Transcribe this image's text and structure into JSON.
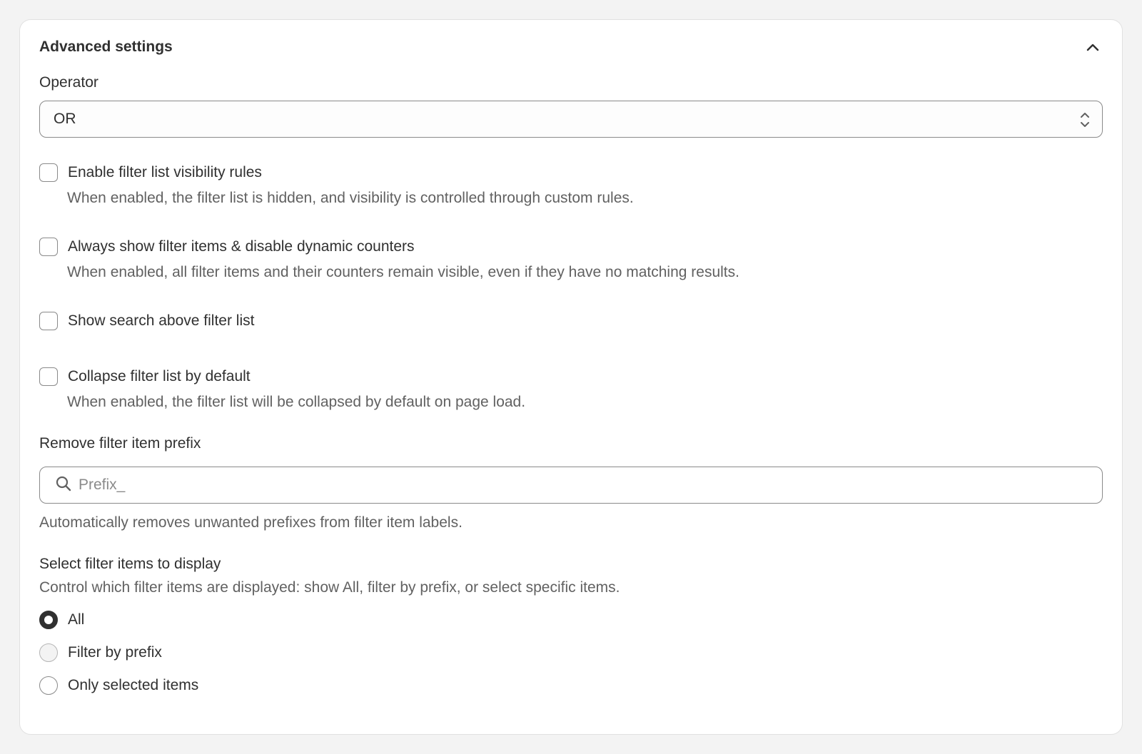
{
  "section": {
    "title": "Advanced settings"
  },
  "operator": {
    "label": "Operator",
    "value": "OR"
  },
  "options": [
    {
      "label": "Enable filter list visibility rules",
      "help": "When enabled, the filter list is hidden, and visibility is controlled through custom rules.",
      "checked": false
    },
    {
      "label": "Always show filter items & disable dynamic counters",
      "help": "When enabled, all filter items and their counters remain visible, even if they have no matching results.",
      "checked": false
    },
    {
      "label": "Show search above filter list",
      "help": "",
      "checked": false
    },
    {
      "label": "Collapse filter list by default",
      "help": "When enabled, the filter list will be collapsed by default on page load.",
      "checked": false
    }
  ],
  "prefix": {
    "label": "Remove filter item prefix",
    "placeholder": "Prefix_",
    "value": "",
    "help": "Automatically removes unwanted prefixes from filter item labels."
  },
  "display": {
    "label": "Select filter items to display",
    "help": "Control which filter items are displayed: show All, filter by prefix, or select specific items.",
    "choices": [
      {
        "label": "All",
        "selected": true
      },
      {
        "label": "Filter by prefix",
        "selected": false
      },
      {
        "label": "Only selected items",
        "selected": false
      }
    ]
  },
  "icons": {
    "collapse": "chevron-up-icon",
    "select": "select-arrows-icon",
    "search": "search-icon"
  }
}
